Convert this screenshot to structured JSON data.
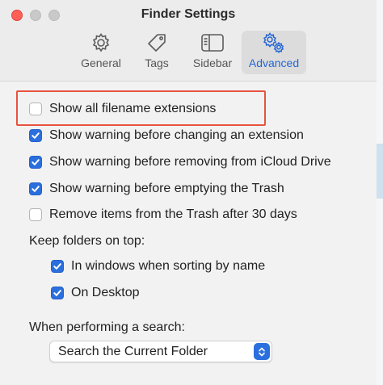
{
  "window": {
    "title": "Finder Settings"
  },
  "tabs": [
    {
      "label": "General",
      "icon": "gear-icon",
      "active": false
    },
    {
      "label": "Tags",
      "icon": "tag-icon",
      "active": false
    },
    {
      "label": "Sidebar",
      "icon": "sidebar-icon",
      "active": false
    },
    {
      "label": "Advanced",
      "icon": "gears-icon",
      "active": true
    }
  ],
  "options": [
    {
      "label": "Show all filename extensions",
      "checked": false,
      "highlighted": true
    },
    {
      "label": "Show warning before changing an extension",
      "checked": true
    },
    {
      "label": "Show warning before removing from iCloud Drive",
      "checked": true
    },
    {
      "label": "Show warning before emptying the Trash",
      "checked": true
    },
    {
      "label": "Remove items from the Trash after 30 days",
      "checked": false
    }
  ],
  "keep_folders": {
    "label": "Keep folders on top:",
    "options": [
      {
        "label": "In windows when sorting by name",
        "checked": true
      },
      {
        "label": "On Desktop",
        "checked": true
      }
    ]
  },
  "search": {
    "label": "When performing a search:",
    "selected": "Search the Current Folder"
  },
  "colors": {
    "accent": "#2b6fde",
    "highlight_border": "#e8533f"
  }
}
